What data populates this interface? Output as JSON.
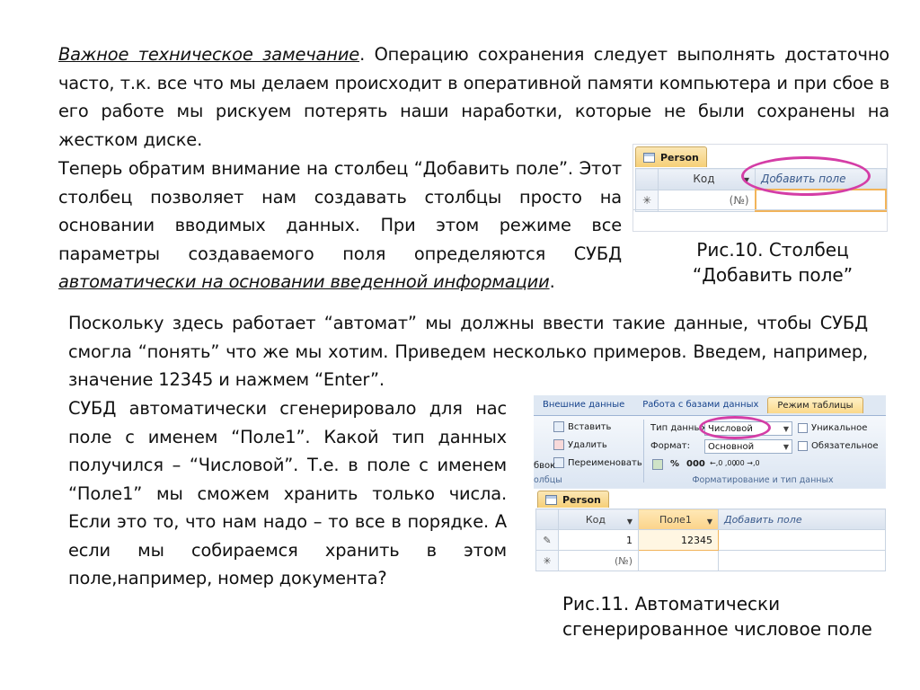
{
  "p1": {
    "label": "Важное техническое замечание",
    "text": ". Операцию сохранения следует выполнять достаточно часто, т.к. все что мы делаем происходит в оперативной памяти компьютера и при сбое в его работе мы рискуем потерять наши наработки, которые не были сохранены на жестком диске."
  },
  "p2": {
    "text": "Теперь обратим внимание на столбец “Добавить поле”. Этот столбец позволяет нам создавать столбцы просто на основании вводимых данных.  При этом режиме все параметры создаваемого поля определяются СУБД ",
    "emph": "автоматически на основании введенной информации",
    "end": "."
  },
  "p3": {
    "text": "Поскольку здесь работает “автомат” мы должны ввести такие данные, чтобы СУБД смогла “понять” что же мы хотим. Приведем несколько примеров. Введем, например, значение 12345 и нажмем “Enter”."
  },
  "p4": {
    "text": "СУБД автоматически сгенерировало для нас поле с именем “Поле1”. Какой тип данных получился – “Числовой”. Т.е. в поле с именем “Поле1” мы сможем хранить только числа. Если это то, что нам надо – то все в порядке. А если мы собираемся хранить в этом поле,например, номер документа?"
  },
  "fig10": {
    "tab": "Person",
    "col_kod": "Код",
    "col_add": "Добавить поле",
    "new_mark": "✳",
    "new_val": "(№)",
    "caption_line1": "Рис.10.  Столбец",
    "caption_line2": "“Добавить поле”"
  },
  "fig11": {
    "tabs": [
      "Внешние данные",
      "Работа с базами данных",
      "Режим таблицы"
    ],
    "insert": "Вставить",
    "delete": "Удалить",
    "rename": "Переименовать",
    "left_fragment": "бвок",
    "group_left": "олбцы",
    "type_label": "Тип данных:",
    "type_value": "Числовой",
    "format_label": "Формат:",
    "format_value": "Основной",
    "unique": "Уникальное",
    "required": "Обязательное",
    "fmt_percent": "%",
    "fmt_000": "000",
    "fmt_inc": "←,0 ,00",
    "fmt_dec": ",00 →,0",
    "group_format": "Форматирование и тип данных",
    "tab": "Person",
    "col_kod": "Код",
    "col_pole": "Поле1",
    "col_add": "Добавить поле",
    "row1_kod": "1",
    "row1_pole": "12345",
    "edit_mark": "✎",
    "new_mark": "✳",
    "new_val": "(№)",
    "caption_line1": "Рис.11. Автоматически",
    "caption_line2": "сгенерированное числовое поле"
  }
}
